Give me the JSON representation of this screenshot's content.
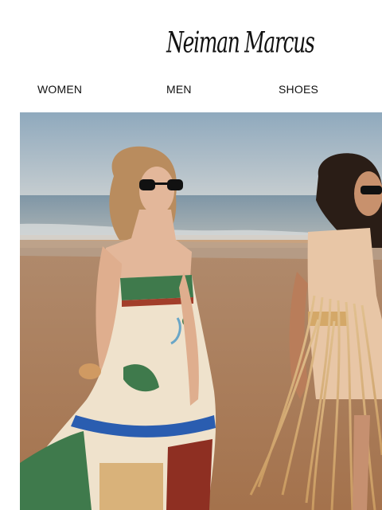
{
  "brand": {
    "logo_text": "Neiman Marcus"
  },
  "nav": {
    "items": [
      {
        "label": "WOMEN"
      },
      {
        "label": "MEN"
      },
      {
        "label": "SHOES"
      }
    ]
  },
  "hero": {
    "colors": {
      "sky_top": "#8fa9bd",
      "sky_bottom": "#c6cdd0",
      "sea": "#7f96a6",
      "sand": "#a97a58",
      "dress_green": "#3f7a4c",
      "dress_cream": "#efe2cc",
      "dress_blue_trim": "#2a5db0",
      "fringe_gold": "#d8b27a"
    }
  }
}
